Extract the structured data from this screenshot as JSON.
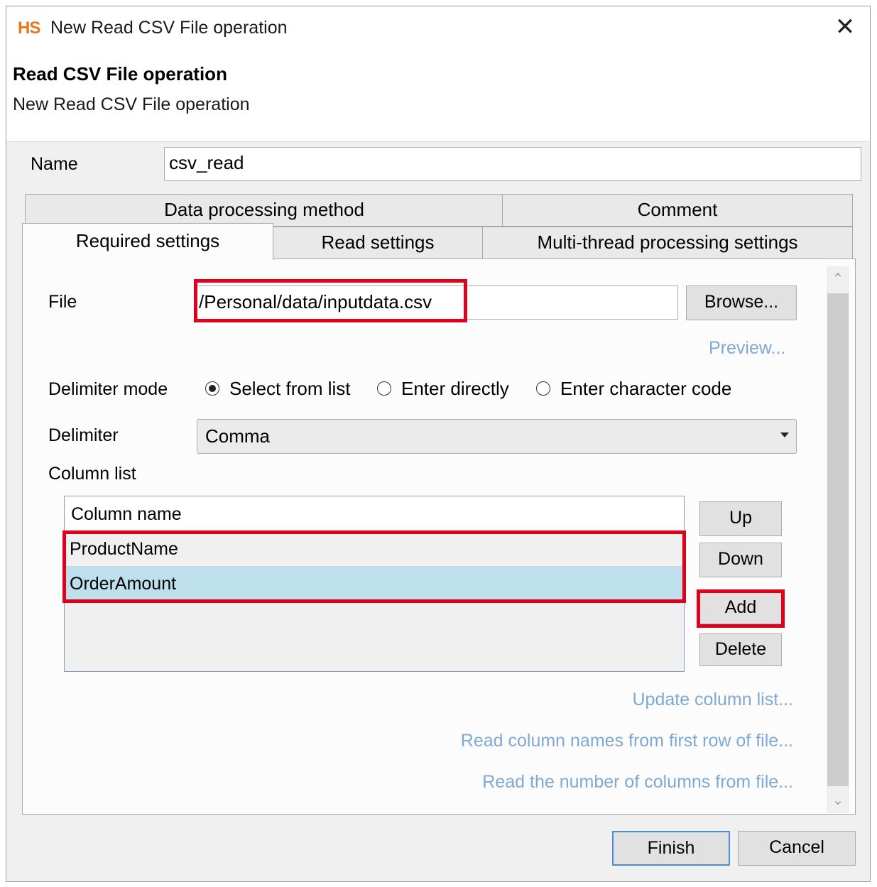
{
  "window": {
    "app_logo": "HS",
    "title": "New Read CSV File operation",
    "close_glyph": "✕"
  },
  "header": {
    "title": "Read CSV File operation",
    "subtitle": "New Read CSV File operation"
  },
  "name_field": {
    "label": "Name",
    "value": "csv_read"
  },
  "tabs": {
    "row1": [
      {
        "label": "Data processing method"
      },
      {
        "label": "Comment"
      }
    ],
    "row2": [
      {
        "label": "Required settings",
        "active": true
      },
      {
        "label": "Read settings"
      },
      {
        "label": "Multi-thread processing settings"
      }
    ]
  },
  "file": {
    "label": "File",
    "value": "/Personal/data/inputdata.csv",
    "browse_label": "Browse...",
    "preview_label": "Preview..."
  },
  "delimiter_mode": {
    "label": "Delimiter mode",
    "options": [
      {
        "label": "Select from list",
        "selected": true
      },
      {
        "label": "Enter directly",
        "selected": false
      },
      {
        "label": "Enter character code",
        "selected": false
      }
    ]
  },
  "delimiter": {
    "label": "Delimiter",
    "value": "Comma"
  },
  "column_list": {
    "label": "Column list",
    "header": "Column name",
    "rows": [
      "ProductName",
      "OrderAmount"
    ],
    "selected_row": "OrderAmount",
    "buttons": {
      "up": "Up",
      "down": "Down",
      "add": "Add",
      "delete": "Delete"
    }
  },
  "links": {
    "update": "Update column list...",
    "read_names": "Read column names from first row of file...",
    "read_count": "Read the number of columns from file..."
  },
  "footer": {
    "finish": "Finish",
    "cancel": "Cancel"
  },
  "colors": {
    "highlight": "#e0001b",
    "link": "#7fa9d4",
    "selected_row": "#bde0ec",
    "logo": "#e8771b"
  },
  "icons": {
    "scroll_up": "chevron-up-icon",
    "scroll_down": "chevron-down-icon",
    "dropdown": "dropdown-arrow-icon",
    "close": "close-icon"
  }
}
